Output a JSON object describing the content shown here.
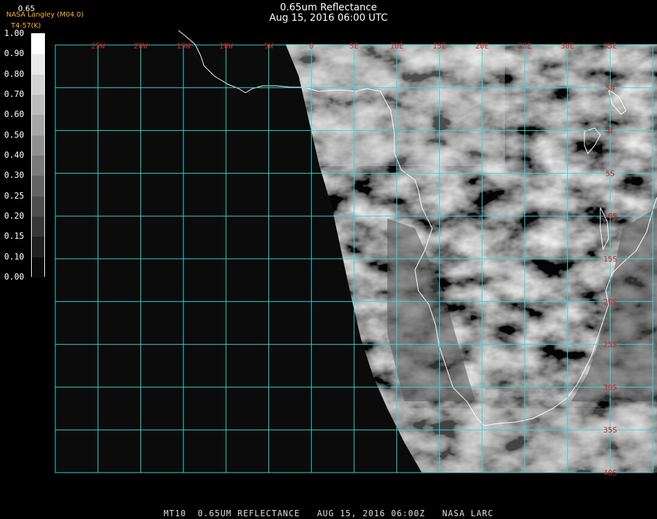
{
  "header": {
    "title": "0.65um Reflectance",
    "datetime": "Aug 15, 2016 06:00 UTC",
    "credit": "NASA Langley (M04.0)",
    "unit": "T4-57(K)",
    "band_label": "0.65"
  },
  "colorbar": {
    "ticks": [
      "1.00",
      "0.90",
      "0.80",
      "0.70",
      "0.60",
      "0.50",
      "0.40",
      "0.30",
      "0.25",
      "0.20",
      "0.15",
      "0.10",
      "0.00"
    ]
  },
  "grid": {
    "lon_labels": [
      "25W",
      "20W",
      "15W",
      "10W",
      "5W",
      "0",
      "5E",
      "10E",
      "15E",
      "20E",
      "25E",
      "30E",
      "35E"
    ],
    "lat_labels": [
      "5N",
      "0",
      "5S",
      "10S",
      "15S",
      "20S",
      "25S",
      "30S",
      "35S",
      "40S"
    ],
    "line_color": "#36d6d8",
    "label_color": "#d42020"
  },
  "footer": {
    "product": "MT10",
    "description": "0.65UM REFLECTANCE",
    "datetime": "AUG 15, 2016 06:00Z",
    "source": "NASA LARC"
  }
}
